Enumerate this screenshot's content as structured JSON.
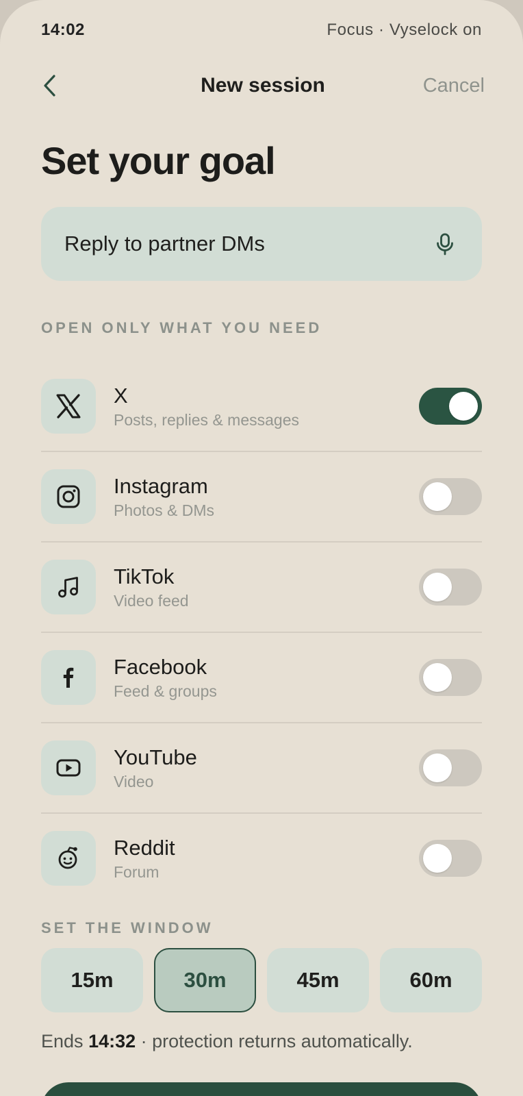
{
  "status": {
    "time": "14:02",
    "focus": "Focus · Vyselock on"
  },
  "nav": {
    "title": "New session",
    "cancel": "Cancel"
  },
  "heading": "Set your goal",
  "goal": {
    "value": "Reply to partner DMs"
  },
  "apps_section_label": "OPEN ONLY WHAT YOU NEED",
  "apps": [
    {
      "name": "X",
      "sub": "Posts, replies & messages",
      "icon": "x-logo-icon",
      "enabled": true
    },
    {
      "name": "Instagram",
      "sub": "Photos & DMs",
      "icon": "instagram-icon",
      "enabled": false
    },
    {
      "name": "TikTok",
      "sub": "Video feed",
      "icon": "music-note-icon",
      "enabled": false
    },
    {
      "name": "Facebook",
      "sub": "Feed & groups",
      "icon": "facebook-icon",
      "enabled": false
    },
    {
      "name": "YouTube",
      "sub": "Video",
      "icon": "youtube-icon",
      "enabled": false
    },
    {
      "name": "Reddit",
      "sub": "Forum",
      "icon": "reddit-icon",
      "enabled": false
    }
  ],
  "window_section_label": "SET THE WINDOW",
  "durations": [
    {
      "label": "15m",
      "selected": false
    },
    {
      "label": "30m",
      "selected": true
    },
    {
      "label": "45m",
      "selected": false
    },
    {
      "label": "60m",
      "selected": false
    }
  ],
  "ends": {
    "prefix": "Ends",
    "time": "14:32",
    "suffix": "· protection returns automatically."
  },
  "colors": {
    "accent": "#2a5442",
    "chip": "#d2ddd5",
    "background": "#e7e0d4"
  }
}
